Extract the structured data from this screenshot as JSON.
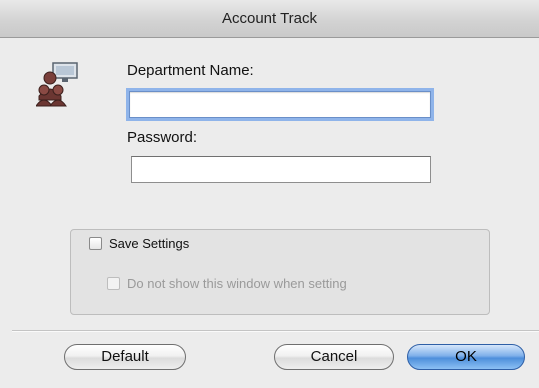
{
  "window": {
    "title": "Account Track"
  },
  "icons": {
    "department": "department-users-icon"
  },
  "form": {
    "department_label": "Department Name:",
    "department_value": "",
    "password_label": "Password:",
    "password_value": ""
  },
  "options": {
    "save_settings_label": "Save Settings",
    "save_settings_checked": false,
    "no_show_label": "Do not show this window when setting",
    "no_show_checked": false,
    "no_show_enabled": false
  },
  "buttons": {
    "default_label": "Default",
    "cancel_label": "Cancel",
    "ok_label": "OK"
  },
  "colors": {
    "focus_ring": "#8fb4ea",
    "ok_button": "#4e8fdb",
    "disabled_text": "#9a9a9a"
  }
}
